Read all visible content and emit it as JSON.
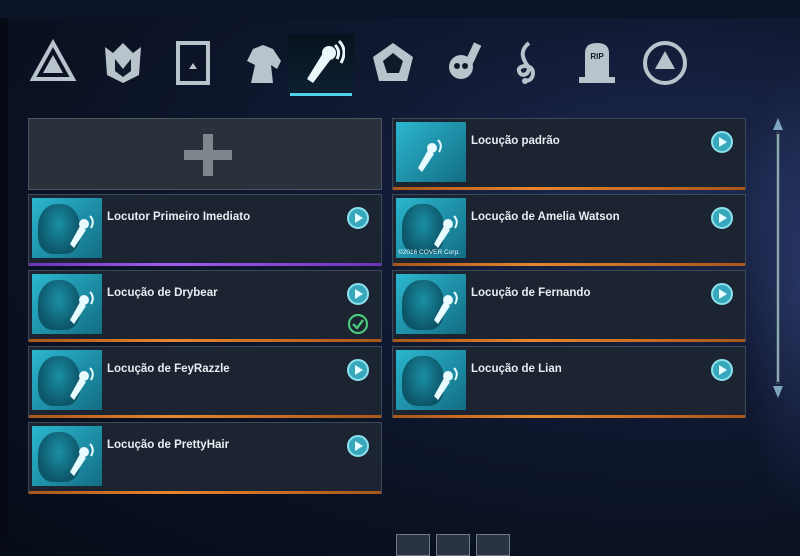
{
  "categories": [
    {
      "name": "emblem-icon",
      "active": false
    },
    {
      "name": "crown-shield-icon",
      "active": false
    },
    {
      "name": "card-icon",
      "active": false
    },
    {
      "name": "horse-icon",
      "active": false
    },
    {
      "name": "announcer-mic-icon",
      "active": true
    },
    {
      "name": "frame-icon",
      "active": false
    },
    {
      "name": "skull-icon",
      "active": false
    },
    {
      "name": "music-clef-icon",
      "active": false
    },
    {
      "name": "tombstone-icon",
      "active": false
    },
    {
      "name": "ring-emblem-icon",
      "active": false
    }
  ],
  "tombstone_text": "RIP",
  "announcers": {
    "left": [
      {
        "title": "Locutor Primeiro Imediato",
        "rarity": "purple",
        "equipped": false
      },
      {
        "title": "Locução de Drybear",
        "rarity": "orange",
        "equipped": true
      },
      {
        "title": "Locução de FeyRazzle",
        "rarity": "orange",
        "equipped": false
      },
      {
        "title": "Locução de PrettyHair",
        "rarity": "orange",
        "equipped": false
      }
    ],
    "right": [
      {
        "title": "Locução padrão",
        "rarity": "orange",
        "equipped": false
      },
      {
        "title": "Locução de Amelia Watson",
        "rarity": "orange",
        "equipped": false,
        "copyright": "©2016 COVER Corp."
      },
      {
        "title": "Locução de Fernando",
        "rarity": "orange",
        "equipped": false
      },
      {
        "title": "Locução de Lian",
        "rarity": "orange",
        "equipped": false
      }
    ]
  },
  "colors": {
    "accent": "#4fd3e6",
    "orange": "#e8862f",
    "purple": "#a35cf0",
    "check": "#49c77a"
  }
}
